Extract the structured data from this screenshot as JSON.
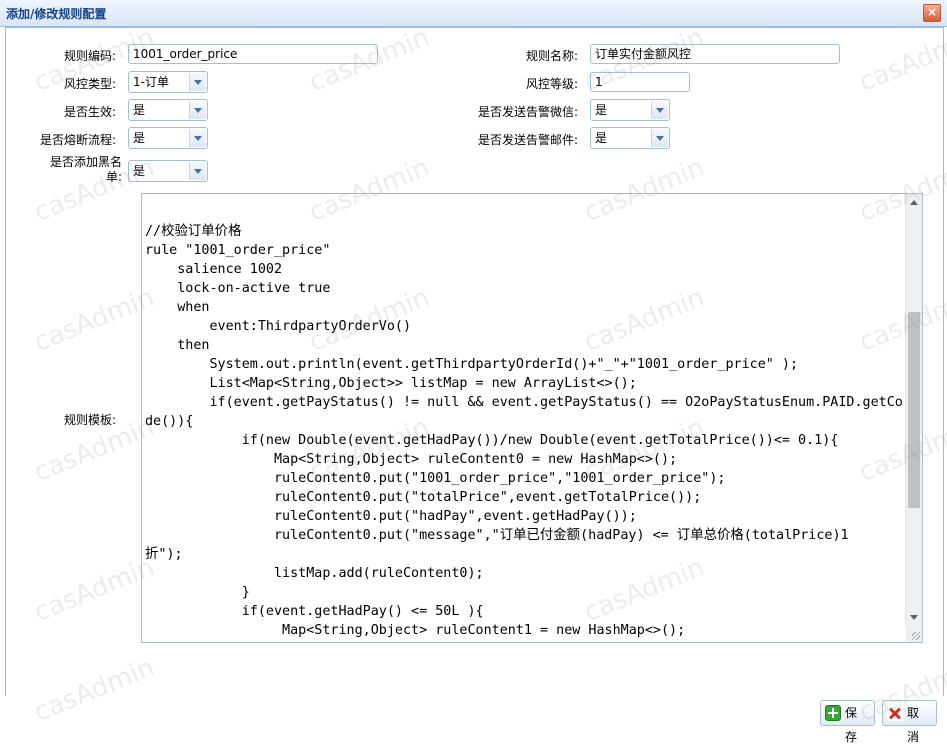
{
  "dialog": {
    "title": "添加/修改规则配置",
    "close_label": "×"
  },
  "form": {
    "rule_code": {
      "label": "规则编码:",
      "value": "1001_order_price"
    },
    "rule_name": {
      "label": "规则名称:",
      "value": "订单实付金额风控"
    },
    "risk_type": {
      "label": "风控类型:",
      "value": "1-订单"
    },
    "risk_level": {
      "label": "风控等级:",
      "value": "1"
    },
    "enabled": {
      "label": "是否生效:",
      "value": "是"
    },
    "send_wechat": {
      "label": "是否发送告警微信:",
      "value": "是"
    },
    "circuit_break": {
      "label": "是否熔断流程:",
      "value": "是"
    },
    "send_email": {
      "label": "是否发送告警邮件:",
      "value": "是"
    },
    "add_blacklist": {
      "label": "是否添加黑名单:",
      "value": "是"
    },
    "template": {
      "label": "规则模板:"
    }
  },
  "template_code": "\n\n//校验订单价格\nrule \"1001_order_price\"\n    salience 1002\n    lock-on-active true\n    when\n        event:ThirdpartyOrderVo()\n    then\n        System.out.println(event.getThirdpartyOrderId()+\"_\"+\"1001_order_price\" );\n        List<Map<String,Object>> listMap = new ArrayList<>();\n        if(event.getPayStatus() != null && event.getPayStatus() == O2oPayStatusEnum.PAID.getCo\nde()){\n            if(new Double(event.getHadPay())/new Double(event.getTotalPrice())<= 0.1){\n                Map<String,Object> ruleContent0 = new HashMap<>();\n                ruleContent0.put(\"1001_order_price\",\"1001_order_price\");\n                ruleContent0.put(\"totalPrice\",event.getTotalPrice());\n                ruleContent0.put(\"hadPay\",event.getHadPay());\n                ruleContent0.put(\"message\",\"订单已付金额(hadPay) <= 订单总价格(totalPrice)1\n折\");\n                listMap.add(ruleContent0);\n            }\n            if(event.getHadPay() <= 50L ){\n                 Map<String,Object> ruleContent1 = new HashMap<>();",
  "buttons": {
    "save": "保存",
    "cancel": "取消"
  },
  "watermark": "casAdmin",
  "colors": {
    "header_text": "#15428b",
    "border": "#99bbe8",
    "save_icon": "#3aa53a",
    "cancel_icon": "#d32a1f"
  }
}
